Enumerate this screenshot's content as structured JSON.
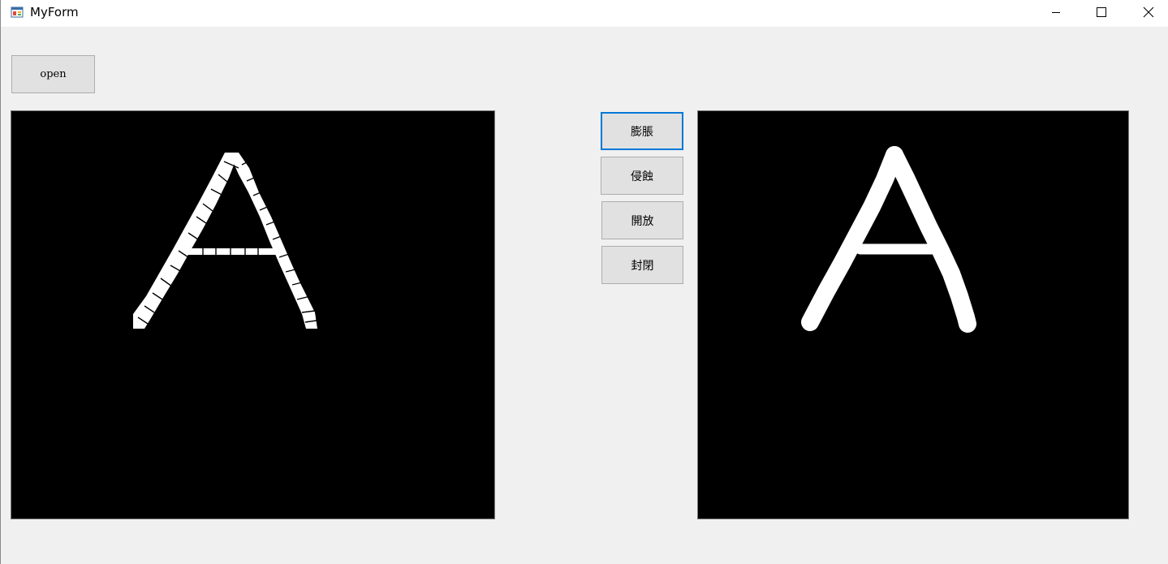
{
  "window": {
    "title": "MyForm",
    "icon": "windows-form-icon",
    "controls": {
      "minimize_icon": "minimize-icon",
      "maximize_icon": "maximize-icon",
      "close_icon": "close-icon"
    }
  },
  "buttons": {
    "open": "open",
    "dilate": "膨脹",
    "erode": "侵蝕",
    "opening": "開放",
    "closing": "封閉"
  },
  "images": {
    "left_picture": "letter-a-binary-image",
    "right_picture": "letter-a-dilated-image"
  },
  "colors": {
    "focus_border": "#0078d7",
    "button_face": "#e1e1e1",
    "form_background": "#f0f0f0"
  }
}
